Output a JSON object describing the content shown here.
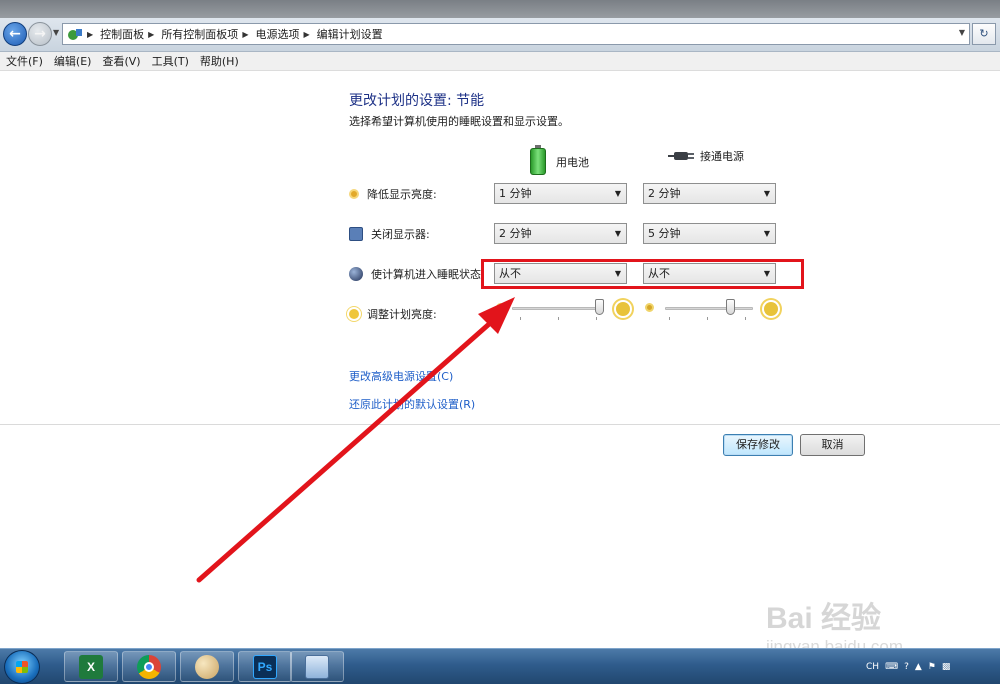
{
  "address_bar": {
    "breadcrumbs": [
      "控制面板",
      "所有控制面板项",
      "电源选项",
      "编辑计划设置"
    ]
  },
  "menubar": {
    "items": [
      "文件(F)",
      "编辑(E)",
      "查看(V)",
      "工具(T)",
      "帮助(H)"
    ]
  },
  "page": {
    "title": "更改计划的设置: 节能",
    "subtitle": "选择希望计算机使用的睡眠设置和显示设置。",
    "columns": {
      "battery": "用电池",
      "plugged_in": "接通电源"
    },
    "rows": [
      {
        "label": "降低显示亮度:",
        "battery": "1 分钟",
        "plugged_in": "2 分钟"
      },
      {
        "label": "关闭显示器:",
        "battery": "2 分钟",
        "plugged_in": "5 分钟"
      },
      {
        "label": "使计算机进入睡眠状态:",
        "battery": "从不",
        "plugged_in": "从不"
      }
    ],
    "brightness": {
      "label": "调整计划亮度:",
      "battery_level": 1.0,
      "plugged_in_level": 0.75
    },
    "links": {
      "advanced": "更改高级电源设置(C)",
      "restore": "还原此计划的默认设置(R)"
    },
    "buttons": {
      "save": "保存修改",
      "cancel": "取消"
    }
  },
  "taskbar": {
    "apps": [
      "excel-icon",
      "chrome-icon",
      "paint-icon",
      "photoshop-icon",
      "control-panel-icon"
    ],
    "tray": {
      "language": "CH"
    }
  },
  "watermark": {
    "brand": "Bai 经验",
    "url": "jingyan.baidu.com"
  },
  "colors": {
    "highlight": "#e2141b",
    "link": "#1e5ec8",
    "title": "#1e3287"
  }
}
